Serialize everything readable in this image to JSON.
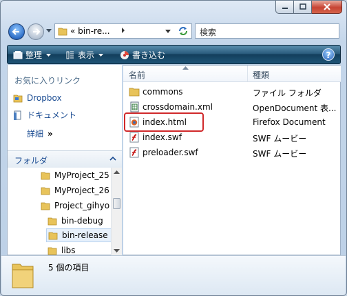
{
  "address": {
    "prefix": "«",
    "path": "bin-re..."
  },
  "search": {
    "placeholder": "検索"
  },
  "toolbar": {
    "organize": "整理",
    "views": "表示",
    "burn": "書き込む"
  },
  "favorites": {
    "title": "お気に入りリンク",
    "items": [
      {
        "label": "Dropbox",
        "icon": "dropbox-folder-icon"
      },
      {
        "label": "ドキュメント",
        "icon": "documents-icon"
      }
    ],
    "details": "詳細",
    "details_chevron": "»"
  },
  "folders": {
    "header": "フォルダ",
    "tree": [
      {
        "label": "MyProject_25"
      },
      {
        "label": "MyProject_26"
      },
      {
        "label": "Project_gihyo"
      },
      {
        "label": "bin-debug"
      },
      {
        "label": "bin-release",
        "selected": true
      },
      {
        "label": "libs"
      }
    ]
  },
  "columns": {
    "name": "名前",
    "type": "種類"
  },
  "files": [
    {
      "name": "commons",
      "type": "ファイル フォルダ",
      "icon": "folder-icon"
    },
    {
      "name": "crossdomain.xml",
      "type": "OpenDocument 表...",
      "icon": "xml-file-icon"
    },
    {
      "name": "index.html",
      "type": "Firefox Document",
      "icon": "firefox-html-icon",
      "highlighted": true
    },
    {
      "name": "index.swf",
      "type": "SWF ムービー",
      "icon": "swf-file-icon"
    },
    {
      "name": "preloader.swf",
      "type": "SWF ムービー",
      "icon": "swf-file-icon"
    }
  ],
  "status": {
    "count": "5 個の項目"
  },
  "colors": {
    "highlight": "#d0282a",
    "link": "#1b4c92"
  }
}
